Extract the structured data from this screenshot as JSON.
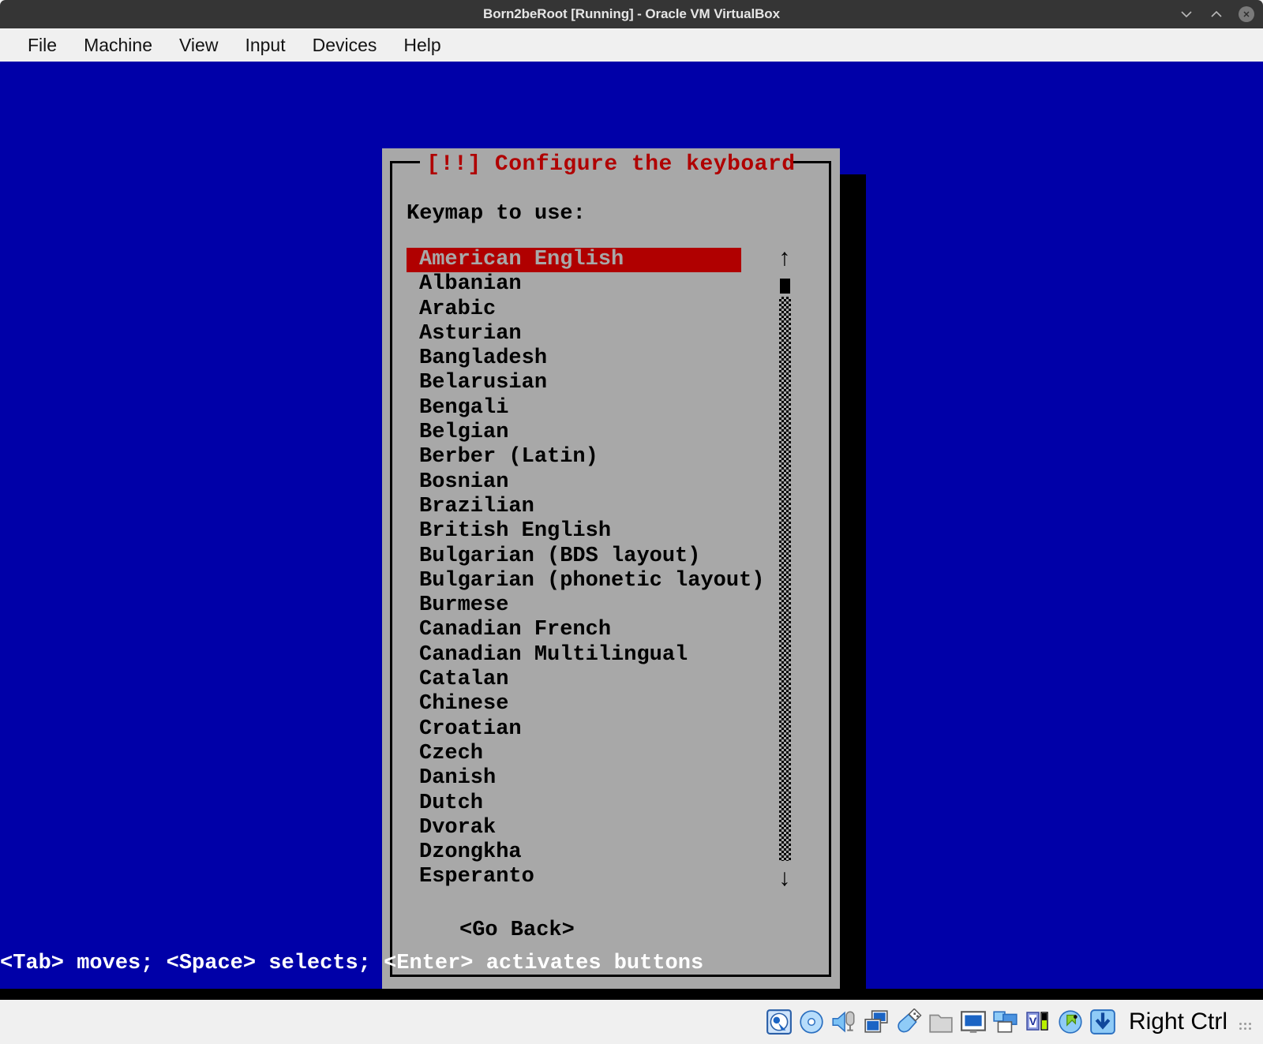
{
  "window": {
    "title": "Born2beRoot [Running] - Oracle VM VirtualBox",
    "controls": [
      {
        "name": "minimize",
        "glyph": "chevron-down"
      },
      {
        "name": "maximize",
        "glyph": "chevron-up"
      },
      {
        "name": "close",
        "glyph": "x"
      }
    ]
  },
  "menubar": {
    "items": [
      "File",
      "Machine",
      "View",
      "Input",
      "Devices",
      "Help"
    ]
  },
  "installer": {
    "dialog_title": "[!!] Configure the keyboard",
    "prompt": "Keymap to use:",
    "selected_index": 0,
    "keymaps": [
      "American English",
      "Albanian",
      "Arabic",
      "Asturian",
      "Bangladesh",
      "Belarusian",
      "Bengali",
      "Belgian",
      "Berber (Latin)",
      "Bosnian",
      "Brazilian",
      "British English",
      "Bulgarian (BDS layout)",
      "Bulgarian (phonetic layout)",
      "Burmese",
      "Canadian French",
      "Canadian Multilingual",
      "Catalan",
      "Chinese",
      "Croatian",
      "Czech",
      "Danish",
      "Dutch",
      "Dvorak",
      "Dzongkha",
      "Esperanto"
    ],
    "go_back_label": "<Go Back>",
    "scrollbar": {
      "up_arrow": "↑",
      "down_arrow": "↓"
    }
  },
  "help_line": "<Tab> moves; <Space> selects; <Enter> activates buttons",
  "statusbar": {
    "icons": [
      "hard-disk-icon",
      "optical-disk-icon",
      "audio-icon",
      "network-icon",
      "usb-icon",
      "shared-folders-icon",
      "display-icon",
      "recording-icon",
      "vm-features-icon",
      "mouse-integration-icon",
      "host-key-icon"
    ],
    "host_key_label": "Right Ctrl"
  },
  "colors": {
    "titlebar_bg": "#353535",
    "menubar_bg": "#f0f0f0",
    "vm_blue": "#0000a8",
    "dialog_gray": "#a8a8a8",
    "accent_red": "#b00000",
    "selected_text": "#a8a8a8",
    "help_text": "#ffffff"
  }
}
